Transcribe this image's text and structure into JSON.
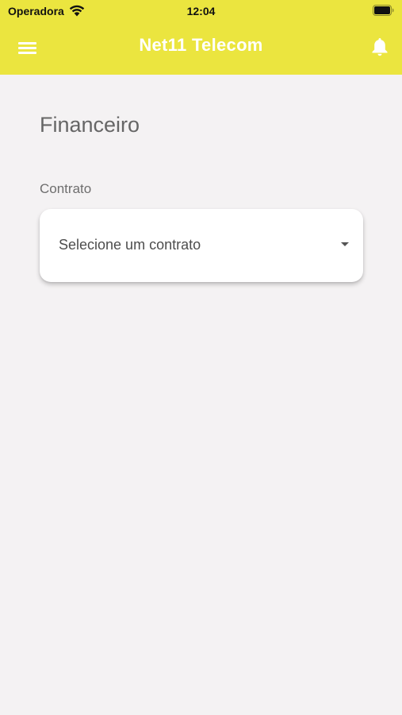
{
  "status_bar": {
    "carrier": "Operadora",
    "time": "12:04",
    "wifi_icon": "wifi-icon",
    "battery_icon": "battery-icon"
  },
  "appbar": {
    "title": "Net11 Telecom",
    "menu_icon": "menu-icon",
    "notification_icon": "bell-icon",
    "background_color": "#ebe53f"
  },
  "page": {
    "title": "Financeiro",
    "contract": {
      "label": "Contrato",
      "placeholder": "Selecione um contrato",
      "dropdown_icon": "caret-down-icon"
    }
  },
  "colors": {
    "accent": "#ebe53f",
    "background": "#f4f2f3",
    "card": "#ffffff"
  }
}
